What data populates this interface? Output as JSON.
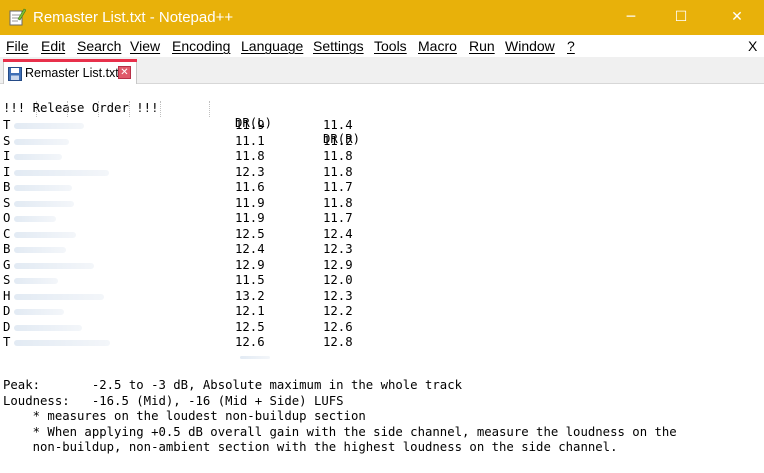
{
  "window": {
    "title": "Remaster List.txt - Notepad++",
    "minimize_glyph": "─",
    "maximize_glyph": "☐",
    "close_glyph": "✕"
  },
  "menu": {
    "items": [
      "File",
      "Edit",
      "Search",
      "View",
      "Encoding",
      "Language",
      "Settings",
      "Tools",
      "Macro",
      "Run",
      "Window",
      "?"
    ],
    "close_label": "X"
  },
  "tab": {
    "label": "Remaster List.txt",
    "close_glyph": "✕",
    "accent_color": "#e8304b"
  },
  "editor": {
    "header": {
      "name": "!!! Release Order !!!",
      "dr_l": "DR(L)",
      "dr_r": "DR(R)"
    },
    "rows": [
      {
        "initial": "T",
        "dr_l": "11.9",
        "dr_r": "11.4"
      },
      {
        "initial": "S",
        "dr_l": "11.1",
        "dr_r": "11.2"
      },
      {
        "initial": "I",
        "dr_l": "11.8",
        "dr_r": "11.8"
      },
      {
        "initial": "I",
        "dr_l": "12.3",
        "dr_r": "11.8"
      },
      {
        "initial": "B",
        "dr_l": "11.6",
        "dr_r": "11.7"
      },
      {
        "initial": "S",
        "dr_l": "11.9",
        "dr_r": "11.8"
      },
      {
        "initial": "O",
        "dr_l": "11.9",
        "dr_r": "11.7"
      },
      {
        "initial": "C",
        "dr_l": "12.5",
        "dr_r": "12.4"
      },
      {
        "initial": "B",
        "dr_l": "12.4",
        "dr_r": "12.3"
      },
      {
        "initial": "G",
        "dr_l": "12.9",
        "dr_r": "12.9"
      },
      {
        "initial": "S",
        "dr_l": "11.5",
        "dr_r": "12.0"
      },
      {
        "initial": "H",
        "dr_l": "13.2",
        "dr_r": "12.3"
      },
      {
        "initial": "D",
        "dr_l": "12.1",
        "dr_r": "12.2"
      },
      {
        "initial": "D",
        "dr_l": "12.5",
        "dr_r": "12.6"
      },
      {
        "initial": "T",
        "dr_l": "12.6",
        "dr_r": "12.8"
      }
    ],
    "notes": [
      "Peak:       -2.5 to -3 dB, Absolute maximum in the whole track",
      "Loudness:   -16.5 (Mid), -16 (Mid + Side) LUFS",
      "    * measures on the loudest non-buildup section",
      "    * When applying +0.5 dB overall gain with the side channel, measure the loudness on the",
      "    non-buildup, non-ambient section with the highest loudness on the side channel."
    ]
  }
}
